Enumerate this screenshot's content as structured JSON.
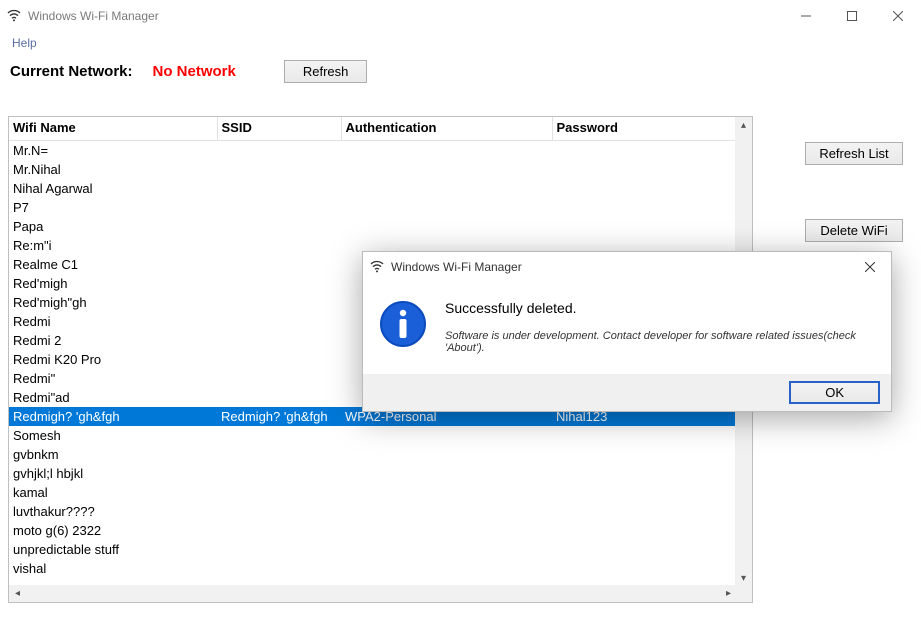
{
  "window": {
    "title": "Windows Wi-Fi Manager"
  },
  "menu": {
    "help": "Help"
  },
  "current_network": {
    "label": "Current Network:",
    "value": "No Network",
    "refresh_btn": "Refresh"
  },
  "side": {
    "refresh_list": "Refresh List",
    "delete_wifi": "Delete WiFi"
  },
  "columns": {
    "wifi_name": "Wifi Name",
    "ssid": "SSID",
    "auth": "Authentication",
    "password": "Password"
  },
  "rows": [
    {
      "name": "Mr.N=",
      "ssid": "",
      "auth": "",
      "pwd": "",
      "selected": false
    },
    {
      "name": "Mr.Nihal",
      "ssid": "",
      "auth": "",
      "pwd": "",
      "selected": false
    },
    {
      "name": "Nihal Agarwal",
      "ssid": "",
      "auth": "",
      "pwd": "",
      "selected": false
    },
    {
      "name": "P7",
      "ssid": "",
      "auth": "",
      "pwd": "",
      "selected": false
    },
    {
      "name": "Papa",
      "ssid": "",
      "auth": "",
      "pwd": "",
      "selected": false
    },
    {
      "name": "Re:m\"i",
      "ssid": "",
      "auth": "",
      "pwd": "",
      "selected": false
    },
    {
      "name": "Realme C1",
      "ssid": "",
      "auth": "",
      "pwd": "",
      "selected": false
    },
    {
      "name": "Red'migh",
      "ssid": "",
      "auth": "",
      "pwd": "",
      "selected": false
    },
    {
      "name": "Red'migh\"gh",
      "ssid": "",
      "auth": "",
      "pwd": "",
      "selected": false
    },
    {
      "name": "Redmi",
      "ssid": "",
      "auth": "",
      "pwd": "",
      "selected": false
    },
    {
      "name": "Redmi 2",
      "ssid": "",
      "auth": "",
      "pwd": "",
      "selected": false
    },
    {
      "name": "Redmi K20 Pro",
      "ssid": "",
      "auth": "",
      "pwd": "",
      "selected": false
    },
    {
      "name": "Redmi\"",
      "ssid": "",
      "auth": "",
      "pwd": "",
      "selected": false
    },
    {
      "name": "Redmi\"ad",
      "ssid": "",
      "auth": "",
      "pwd": "",
      "selected": false
    },
    {
      "name": "Redmigh? 'gh&fgh",
      "ssid": "Redmigh? 'gh&fgh",
      "auth": "WPA2-Personal",
      "pwd": "Nihal123",
      "selected": true
    },
    {
      "name": "Somesh",
      "ssid": "",
      "auth": "",
      "pwd": "",
      "selected": false
    },
    {
      "name": "gvbnkm",
      "ssid": "",
      "auth": "",
      "pwd": "",
      "selected": false
    },
    {
      "name": "gvhjkl;l hbjkl",
      "ssid": "",
      "auth": "",
      "pwd": "",
      "selected": false
    },
    {
      "name": "kamal",
      "ssid": "",
      "auth": "",
      "pwd": "",
      "selected": false
    },
    {
      "name": "luvthakur????",
      "ssid": "",
      "auth": "",
      "pwd": "",
      "selected": false
    },
    {
      "name": "moto g(6) 2322",
      "ssid": "",
      "auth": "",
      "pwd": "",
      "selected": false
    },
    {
      "name": "unpredictable stuff",
      "ssid": "",
      "auth": "",
      "pwd": "",
      "selected": false
    },
    {
      "name": "vishal",
      "ssid": "",
      "auth": "",
      "pwd": "",
      "selected": false
    }
  ],
  "dialog": {
    "title": "Windows Wi-Fi Manager",
    "big_text": "Successfully deleted.",
    "small_text": "Software is under development. Contact developer for software related issues(check 'About').",
    "ok": "OK"
  }
}
